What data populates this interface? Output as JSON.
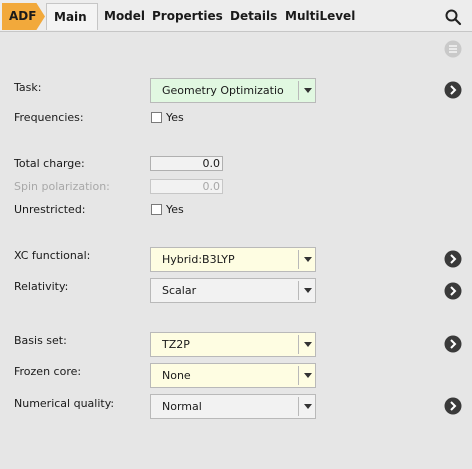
{
  "tabs": {
    "adf": "ADF",
    "items": [
      "Main",
      "Model",
      "Properties",
      "Details",
      "MultiLevel"
    ],
    "active": "Main"
  },
  "icons": {
    "search": "search-icon",
    "panel_menu": "panel-menu-icon",
    "go": "arrow-right-circle-icon"
  },
  "colors": {
    "adf_tab": "#f2a93b",
    "task_field": "#e1f8e1",
    "highlight_field": "#fefde2",
    "default_field": "#f2f2f2"
  },
  "form": {
    "task": {
      "label": "Task:",
      "value": "Geometry Optimizatio"
    },
    "frequencies": {
      "label": "Frequencies:",
      "check": "Yes",
      "checked": false
    },
    "total_charge": {
      "label": "Total charge:",
      "value": "0.0"
    },
    "spin_polarization": {
      "label": "Spin polarization:",
      "value": "0.0",
      "disabled": true
    },
    "unrestricted": {
      "label": "Unrestricted:",
      "check": "Yes",
      "checked": false
    },
    "xc_functional": {
      "label": "XC functional:",
      "value": "Hybrid:B3LYP"
    },
    "relativity": {
      "label": "Relativity:",
      "value": "Scalar"
    },
    "basis_set": {
      "label": "Basis set:",
      "value": "TZ2P"
    },
    "frozen_core": {
      "label": "Frozen core:",
      "value": "None"
    },
    "numerical_quality": {
      "label": "Numerical quality:",
      "value": "Normal"
    }
  }
}
